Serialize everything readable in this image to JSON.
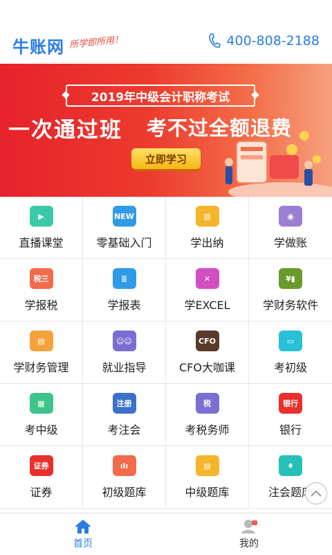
{
  "header": {
    "logo": "牛账网",
    "slogan": "所学即所用！",
    "phone": "400-808-2188"
  },
  "banner": {
    "title": "2019年中级会计职称考试",
    "headline": "一次通过班",
    "subline": "考不过全额退费",
    "button": "立即学习"
  },
  "colors": {
    "brand": "#2a7de1",
    "banner_red": "#e6222b",
    "active_tab": "#2a7de1"
  },
  "grid": [
    {
      "label": "直播课堂",
      "icon": "tv-icon",
      "color": "#3cc9a8",
      "glyph": "▶"
    },
    {
      "label": "零基础入门",
      "icon": "new-icon",
      "color": "#2f9be6",
      "glyph": "NEW"
    },
    {
      "label": "学出纳",
      "icon": "book-icon",
      "color": "#f5b52a",
      "glyph": "▥"
    },
    {
      "label": "学做账",
      "icon": "ledger-icon",
      "color": "#9b7fd3",
      "glyph": "◉"
    },
    {
      "label": "学报税",
      "icon": "tax-form-icon",
      "color": "#f26b4b",
      "glyph": "税三"
    },
    {
      "label": "学报表",
      "icon": "report-icon",
      "color": "#2f9be6",
      "glyph": "≣"
    },
    {
      "label": "学EXCEL",
      "icon": "excel-icon",
      "color": "#d14fc3",
      "glyph": "✕"
    },
    {
      "label": "学财务软件",
      "icon": "finance-software-icon",
      "color": "#6a9a2c",
      "glyph": "¥▮"
    },
    {
      "label": "学财务管理",
      "icon": "finance-management-icon",
      "color": "#f5a23a",
      "glyph": "▤"
    },
    {
      "label": "就业指导",
      "icon": "people-icon",
      "color": "#7a6fd0",
      "glyph": "☺☺"
    },
    {
      "label": "CFO大咖课",
      "icon": "cfo-icon",
      "color": "#5a3a28",
      "glyph": "CFO"
    },
    {
      "label": "考初级",
      "icon": "card-icon",
      "color": "#27c0d6",
      "glyph": "▭"
    },
    {
      "label": "考中级",
      "icon": "certificate-icon",
      "color": "#3cc48b",
      "glyph": "▦"
    },
    {
      "label": "考注会",
      "icon": "register-icon",
      "color": "#3b72c9",
      "glyph": "注册"
    },
    {
      "label": "考税务师",
      "icon": "tax-icon",
      "color": "#7a6fd0",
      "glyph": "税"
    },
    {
      "label": "银行",
      "icon": "bank-icon",
      "color": "#e8302c",
      "glyph": "银行"
    },
    {
      "label": "证券",
      "icon": "securities-icon",
      "color": "#e8302c",
      "glyph": "证券"
    },
    {
      "label": "初级题库",
      "icon": "chart-icon",
      "color": "#f26b4b",
      "glyph": "ılı"
    },
    {
      "label": "中级题库",
      "icon": "document-icon",
      "color": "#f5b52a",
      "glyph": "▤"
    },
    {
      "label": "注会题库",
      "icon": "tie-icon",
      "color": "#27c0b6",
      "glyph": "♦"
    }
  ],
  "tabbar": {
    "tabs": [
      {
        "label": "首页",
        "icon": "home-icon",
        "active": true
      },
      {
        "label": "我的",
        "icon": "user-icon",
        "active": false
      }
    ]
  }
}
